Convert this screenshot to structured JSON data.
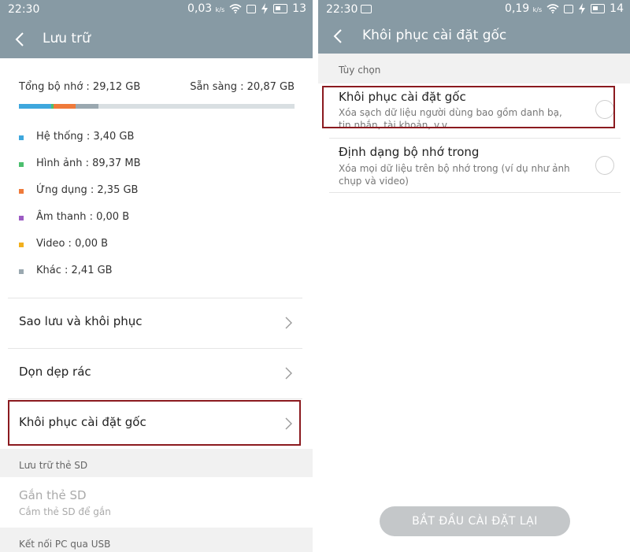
{
  "left": {
    "status": {
      "time": "22:30",
      "speed": "0,03",
      "speed_unit": "k/s",
      "battery": "13"
    },
    "appbar": {
      "title": "Lưu trữ"
    },
    "storage": {
      "total": "Tổng bộ nhớ : 29,12 GB",
      "available": "Sẵn sàng : 20,87 GB",
      "segments": [
        {
          "name": "Hệ thống",
          "fraction": 0.117,
          "color": "#3ea7dd"
        },
        {
          "name": "Hình ảnh",
          "fraction": 0.008,
          "color": "#4cbf6e"
        },
        {
          "name": "Ứng dụng",
          "fraction": 0.081,
          "color": "#ef7a3a"
        },
        {
          "name": "Khác",
          "fraction": 0.083,
          "color": "#9aa8b0"
        }
      ]
    },
    "legend": [
      {
        "label": "Hệ thống : 3,40 GB",
        "color": "#3ea7dd"
      },
      {
        "label": "Hình ảnh : 89,37 MB",
        "color": "#4cbf6e"
      },
      {
        "label": "Ứng dụng : 2,35 GB",
        "color": "#ef7a3a"
      },
      {
        "label": "Âm thanh : 0,00 B",
        "color": "#9c5bc3"
      },
      {
        "label": "Video : 0,00 B",
        "color": "#f2b01e"
      },
      {
        "label": "Khác : 2,41 GB",
        "color": "#9aa8b0"
      }
    ],
    "menu": [
      {
        "label": "Sao lưu và khôi phục"
      },
      {
        "label": "Dọn dẹp rác"
      },
      {
        "label": "Khôi phục cài đặt gốc"
      }
    ],
    "sd_section": {
      "header": "Lưu trữ thẻ SD",
      "title": "Gắn thẻ SD",
      "subtitle": "Cắm thẻ SD để gắn"
    },
    "usb_section": {
      "header": "Kết nối PC qua USB"
    }
  },
  "right": {
    "status": {
      "time": "22:30",
      "speed": "0,19",
      "speed_unit": "k/s",
      "battery": "14"
    },
    "appbar": {
      "title": "Khôi phục cài đặt gốc"
    },
    "options_header": "Tùy chọn",
    "options": [
      {
        "title": "Khôi phục cài đặt gốc",
        "subtitle": "Xóa sạch dữ liệu người dùng bao gồm danh bạ, tin nhắn, tài khoản, v.v..."
      },
      {
        "title": "Định dạng bộ nhớ trong",
        "subtitle": "Xóa mọi dữ liệu trên bộ nhớ trong (ví dụ như ảnh chụp và video)"
      }
    ],
    "button": "BẮT ĐẦU CÀI ĐẶT LẠI"
  },
  "colors": {
    "appbar": "#879aa4",
    "highlight_box": "#8b1a1f"
  }
}
